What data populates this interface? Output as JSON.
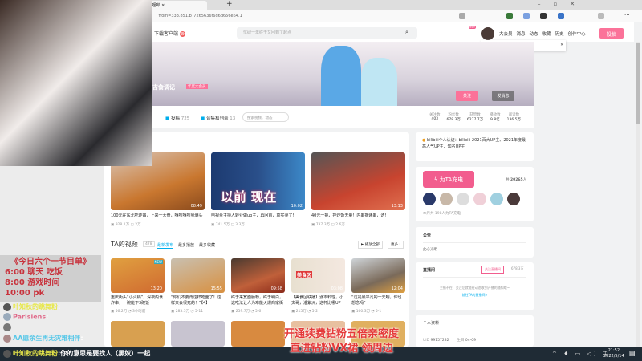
{
  "browser": {
    "tab_title": "_哔哩哔",
    "url": "_from=333.851.b_7265636f6d6d656e64.1"
  },
  "header": {
    "download_client": "下载客户端",
    "search_placeholder": "忙碌一年终于又回到了起点",
    "links": [
      "大会员",
      "消息",
      "动态",
      "收藏",
      "历史",
      "创作中心"
    ],
    "message_badge": "99+",
    "upload_button": "投稿",
    "notice": "你有8条充电消息",
    "notice_link": "查看详情"
  },
  "profile": {
    "name": "吉食调记",
    "vip_badge": "年度大会员",
    "sign": "...",
    "follow": "关注",
    "message": "发消息"
  },
  "nav": {
    "items": [
      {
        "label": "投稿",
        "count": "725"
      },
      {
        "label": "合集和列表",
        "count": "13"
      }
    ],
    "search_placeholder": "搜索视频、动态"
  },
  "stats": [
    {
      "label": "关注数",
      "value": "403"
    },
    {
      "label": "粉丝数",
      "value": "678.3万"
    },
    {
      "label": "获赞数",
      "value": "6277.7万"
    },
    {
      "label": "播放数",
      "value": "9.8亿"
    },
    {
      "label": "阅读数",
      "value": "136.5万"
    }
  ],
  "featured": [
    {
      "title": "100元在东北吃炸串，上来一大盘，嘎吱嘎吱我俩头",
      "views": "928.1万",
      "comments": "2万",
      "duration": "08:49"
    },
    {
      "title": "电视台主持人转业做up主，再回首，真实哭了!",
      "views": "741.5万",
      "comments": "3.3万",
      "duration": "10:02",
      "overlay": "以前 现在"
    },
    {
      "title": "40元一把，拌炸饭无量！内串撸烤串，透!",
      "views": "737.3万",
      "comments": "2.6万",
      "duration": "13:13"
    }
  ],
  "videos_section": {
    "title": "TA的视频",
    "count": "478",
    "tabs": [
      "最新发布",
      "最多播放",
      "最多收藏"
    ],
    "play_all": "播放全部",
    "more": "更多"
  },
  "videos": [
    {
      "title": "重庆街头“小火锅”，深夜内食炸串，一碗能下3碗饭",
      "views": "56.2万",
      "date": "3小时前",
      "duration": "13:20",
      "badge": "NEW"
    },
    {
      "title": "“你们不要再这样吃面了！这样只会很死的！”【4】",
      "views": "283.5万",
      "date": "5-11",
      "duration": "15:55"
    },
    {
      "title": "终于来宽面肠粉，终于明白，这吃法让人为难能火爆商家街头",
      "views": "259.7万",
      "date": "5-6",
      "duration": "09:58"
    },
    {
      "title": "【美食区联播】涨本料理，小文哥，潘紫洲，这杯比哪UP",
      "views": "215万",
      "date": "5-2",
      "duration": "03:08",
      "overlay": "美食区"
    },
    {
      "title": "“这是最平凡的一天啊，你也想念吗”",
      "views": "160.3万",
      "date": "5-1",
      "duration": "12:04"
    }
  ],
  "sidebar": {
    "cert": "bilibili个人认证：bilibili 2021百大UP主、2021年度最高人气UP主、知名UP主",
    "charge_button": "为TA充电",
    "charge_total_prefix": "共",
    "charge_total": "20265",
    "charge_total_suffix": "人",
    "charge_month": "本月共 198人为TA充电",
    "notice_title": "公告",
    "notice_text": "此心光明",
    "live_title": "直播间",
    "live_follow": "关注直播间",
    "live_fans": "678.3万",
    "live_offline": "主播不在，关注后就能在动态收到开播的通知哦~",
    "live_link": "前往TA的直播间",
    "info_title": "个人资料",
    "uid_label": "UID",
    "uid": "99157282",
    "birthday_label": "生日",
    "birthday": "04-09"
  },
  "stream": {
    "schedule": [
      "《今日六个一节目单》",
      "6:00 聊天 吃饭",
      "8:00 游戏时间",
      "10:00 pk"
    ],
    "chat": [
      {
        "user": "叶知秋的跳舞粉",
        "msg": ":"
      },
      {
        "user": "Parisiens",
        "msg": ":"
      },
      {
        "user": "",
        "msg": ""
      },
      {
        "user": "AA愿余生再无灾难相伴",
        "msg": ":"
      },
      {
        "user": "叶知秋的跳舞粉",
        "msg": ":你的意思是要找人（黑奴）一起"
      }
    ],
    "promo": [
      "开通续费钻粉五倍亲密度",
      "直进钻粉VX裙 领周边"
    ]
  },
  "taskbar": {
    "time": "21:52",
    "date": "2022/5/14"
  },
  "colors": {
    "pink": "#fb7299",
    "blue": "#00aeec"
  }
}
